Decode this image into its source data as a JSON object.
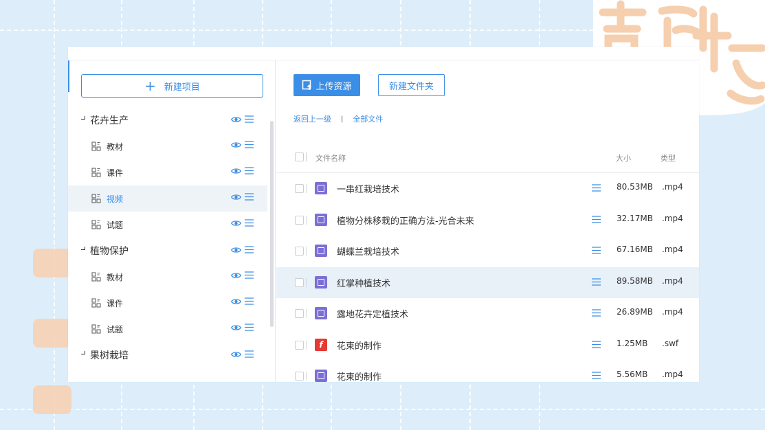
{
  "sidebar": {
    "new_project_label": "新建项目",
    "groups": [
      {
        "label": "花卉生产",
        "children": [
          "教材",
          "课件",
          "视频",
          "试题"
        ]
      },
      {
        "label": "植物保护",
        "children": [
          "教材",
          "课件",
          "试题"
        ]
      },
      {
        "label": "果树栽培",
        "children": []
      }
    ],
    "selected": "视频"
  },
  "toolbar": {
    "upload_label": "上传资源",
    "new_folder_label": "新建文件夹"
  },
  "breadcrumb": {
    "back_label": "返回上一级",
    "separator": "|",
    "all_files_label": "全部文件"
  },
  "table": {
    "headers": {
      "name": "文件名称",
      "size": "大小",
      "type": "类型"
    },
    "rows": [
      {
        "name": "一串红栽培技术",
        "size": "80.53MB",
        "type": ".mp4",
        "icon": "video-file-icon"
      },
      {
        "name": "植物分株移栽的正确方法-光合未来",
        "size": "32.17MB",
        "type": ".mp4",
        "icon": "video-file-icon"
      },
      {
        "name": "蝴蝶兰栽培技术",
        "size": "67.16MB",
        "type": ".mp4",
        "icon": "video-file-icon"
      },
      {
        "name": "红掌种植技术",
        "size": "89.58MB",
        "type": ".mp4",
        "icon": "video-file-icon"
      },
      {
        "name": "露地花卉定植技术",
        "size": "26.89MB",
        "type": ".mp4",
        "icon": "video-file-icon"
      },
      {
        "name": "花束的制作",
        "size": "1.25MB",
        "type": ".swf",
        "icon": "flash-file-icon"
      },
      {
        "name": "花束的制作",
        "size": "5.56MB",
        "type": ".mp4",
        "icon": "video-file-icon"
      }
    ]
  },
  "colors": {
    "accent": "#3a8ee6",
    "background": "#ddeefa",
    "selected_row": "#eef3f8",
    "hover_row": "#e8f0f8",
    "video_icon": "#7b6fd6",
    "flash_icon": "#e53935",
    "seal": "#f6d2b5"
  }
}
